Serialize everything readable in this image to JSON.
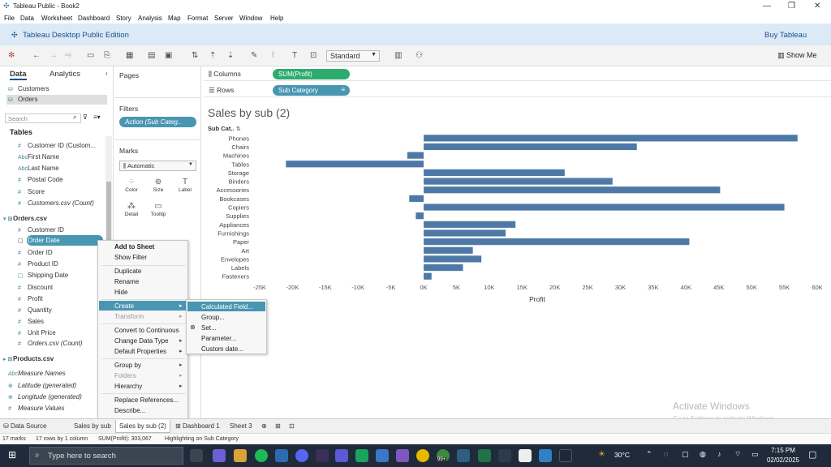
{
  "window": {
    "title": "Tableau Public - Book2"
  },
  "menu": [
    "File",
    "Data",
    "Worksheet",
    "Dashboard",
    "Story",
    "Analysis",
    "Map",
    "Format",
    "Server",
    "Window",
    "Help"
  ],
  "brand": {
    "name": "Tableau Desktop Public Edition",
    "buy": "Buy Tableau"
  },
  "toolbar": {
    "fit": "Standard",
    "show_me": "Show Me"
  },
  "data_pane": {
    "tabs": [
      "Data",
      "Analytics"
    ],
    "sources": [
      "Customers",
      "Orders"
    ],
    "search_placeholder": "Search",
    "tables_header": "Tables",
    "customer_fields": [
      "Customer ID (Custom...",
      "First Name",
      "Last Name",
      "Postal Code",
      "Score",
      "Customers.csv (Count)"
    ],
    "orders_header": "Orders.csv",
    "orders_fields": [
      "Customer ID",
      "Order Date",
      "Order ID",
      "Product ID",
      "Shipping Date",
      "Discount",
      "Profit",
      "Quantity",
      "Sales",
      "Unit Price",
      "Orders.csv (Count)"
    ],
    "products_header": "Products.csv",
    "extra_fields": [
      "Measure Names",
      "Latitude (generated)",
      "Longitude (generated)",
      "Measure Values"
    ]
  },
  "cards": {
    "pages": "Pages",
    "filters": "Filters",
    "filter_pill": "Action (Sub Categ..",
    "marks": "Marks",
    "marks_type": "Automatic",
    "mark_buttons": [
      "Color",
      "Size",
      "Label",
      "Detail",
      "Tooltip"
    ]
  },
  "shelves": {
    "columns_label": "Columns",
    "columns_pill": "SUM(Profit)",
    "rows_label": "Rows",
    "rows_pill": "Sub Category"
  },
  "context_menu": {
    "items": [
      "Add to Sheet",
      "Show Filter",
      "Duplicate",
      "Rename",
      "Hide",
      "Create",
      "Transform",
      "Convert to Continuous",
      "Change Data Type",
      "Default Properties",
      "Group by",
      "Folders",
      "Hierarchy",
      "Replace References...",
      "Describe..."
    ],
    "submenu": [
      "Calculated Field...",
      "Group...",
      "Set...",
      "Parameter...",
      "Custom date..."
    ]
  },
  "colors": {
    "bar": "#4e79a7",
    "columns_pill": "#2eab6e",
    "rows_pill": "#4996b2",
    "accent": "#1a4f8a"
  },
  "chart_data": {
    "type": "bar",
    "title": "Sales by sub (2)",
    "xlabel": "Profit",
    "ylabel": "Sub Cat..",
    "categories": [
      "Phones",
      "Chairs",
      "Machines",
      "Tables",
      "Storage",
      "Binders",
      "Accessories",
      "Bookcases",
      "Copiers",
      "Supplies",
      "Appliances",
      "Furnishings",
      "Paper",
      "Art",
      "Envelopes",
      "Labels",
      "Fasteners"
    ],
    "values": [
      57000,
      32500,
      -2500,
      -21000,
      21500,
      28800,
      45200,
      -2200,
      55000,
      -1200,
      14000,
      12500,
      40500,
      7500,
      8800,
      6000,
      1200
    ],
    "xlim": [
      -25000,
      60000
    ],
    "ticks": [
      "-25K",
      "-20K",
      "-15K",
      "-10K",
      "-5K",
      "0K",
      "5K",
      "10K",
      "15K",
      "20K",
      "25K",
      "30K",
      "35K",
      "40K",
      "45K",
      "50K",
      "55K",
      "60K"
    ],
    "tick_values": [
      -25000,
      -20000,
      -15000,
      -10000,
      -5000,
      0,
      5000,
      10000,
      15000,
      20000,
      25000,
      30000,
      35000,
      40000,
      45000,
      50000,
      55000,
      60000
    ],
    "grid": false
  },
  "sheet_tabs": [
    "Data Source",
    "Sales by sub",
    "Sales by sub (2)",
    "Dashboard 1",
    "Sheet 3"
  ],
  "status": [
    "17 marks",
    "17 rows by 1 column",
    "SUM(Profit): 303,067",
    "Highlighting on Sub Category"
  ],
  "activate": {
    "line1": "Activate Windows",
    "line2": "Go to Settings to activate Windows."
  },
  "taskbar": {
    "search": "Type here to search",
    "temp": "30°C",
    "time": "7:15 PM",
    "date": "02/02/2025",
    "badge": "99+"
  }
}
